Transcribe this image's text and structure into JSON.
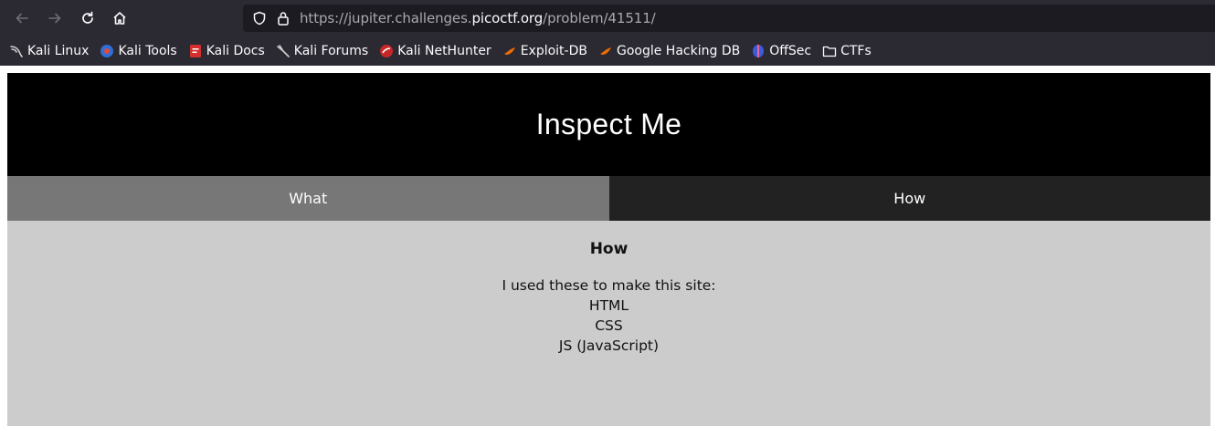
{
  "browser": {
    "url_prefix": "https://jupiter.challenges.",
    "url_domain": "picoctf.org",
    "url_path": "/problem/41511/",
    "bookmarks": [
      {
        "label": "Kali Linux",
        "icon": "kali-dragon-icon"
      },
      {
        "label": "Kali Tools",
        "icon": "kali-tools-icon"
      },
      {
        "label": "Kali Docs",
        "icon": "kali-docs-icon"
      },
      {
        "label": "Kali Forums",
        "icon": "kali-forums-icon"
      },
      {
        "label": "Kali NetHunter",
        "icon": "nethunter-icon"
      },
      {
        "label": "Exploit-DB",
        "icon": "exploit-db-icon"
      },
      {
        "label": "Google Hacking DB",
        "icon": "ghdb-icon"
      },
      {
        "label": "OffSec",
        "icon": "offsec-icon"
      },
      {
        "label": "CTFs",
        "icon": "folder-icon"
      }
    ]
  },
  "page": {
    "title": "Inspect Me",
    "tabs": [
      {
        "label": "What"
      },
      {
        "label": "How"
      }
    ],
    "content": {
      "heading": "How",
      "lines": [
        "I used these to make this site:",
        "HTML",
        "CSS",
        "JS (JavaScript)"
      ]
    }
  },
  "colors": {
    "header_bg": "#000000",
    "tab_what_bg": "#777777",
    "tab_how_bg": "#222222",
    "content_bg": "#cccccc"
  }
}
